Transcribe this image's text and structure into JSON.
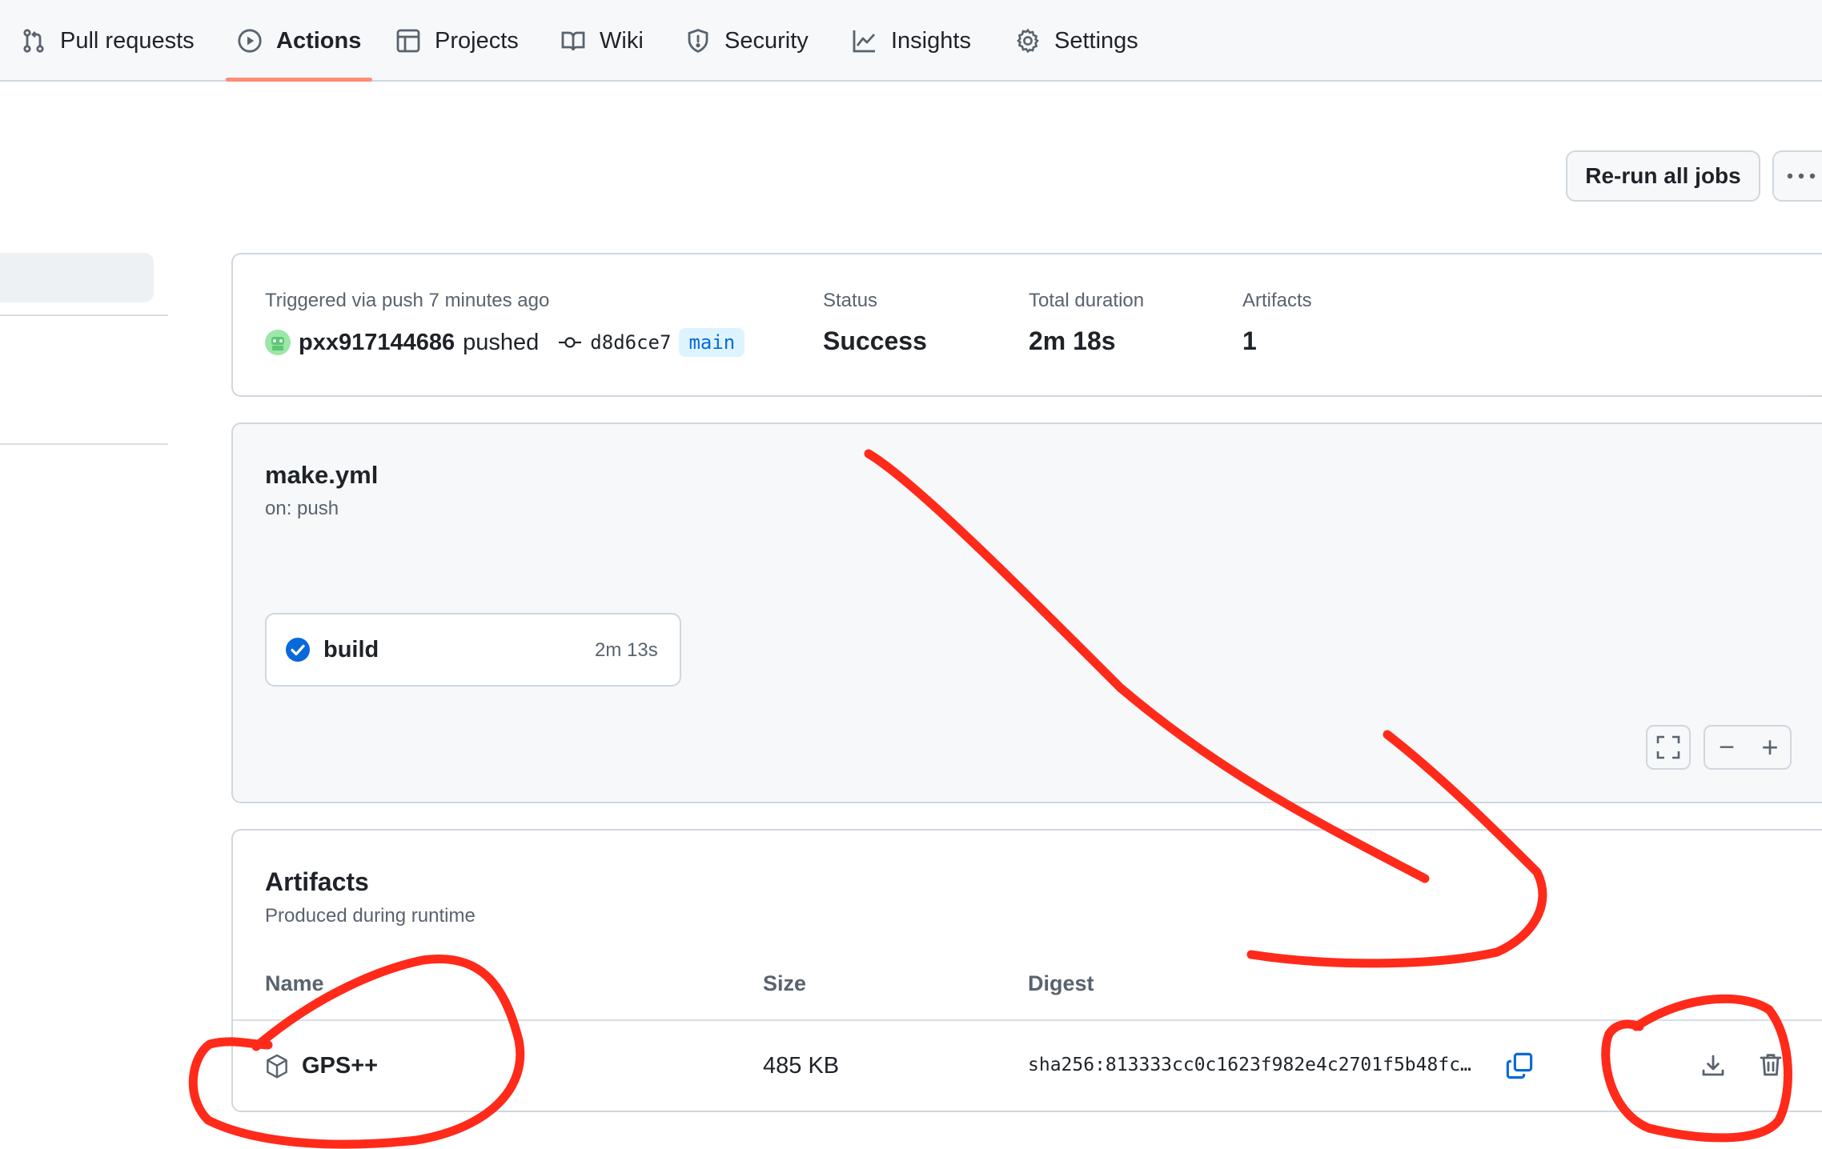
{
  "nav": {
    "tabs": [
      {
        "label": "Pull requests",
        "icon": "git-pull-request-icon"
      },
      {
        "label": "Actions",
        "icon": "play-icon",
        "active": true
      },
      {
        "label": "Projects",
        "icon": "table-icon"
      },
      {
        "label": "Wiki",
        "icon": "book-icon"
      },
      {
        "label": "Security",
        "icon": "shield-icon"
      },
      {
        "label": "Insights",
        "icon": "graph-icon"
      },
      {
        "label": "Settings",
        "icon": "gear-icon"
      }
    ]
  },
  "header": {
    "rerun_label": "Re-run all jobs",
    "more_label": "···"
  },
  "summary": {
    "trigger_text": "Triggered via push 7 minutes ago",
    "actor": "pxx917144686",
    "action": "pushed",
    "commit": "d8d6ce7",
    "branch": "main",
    "status_label": "Status",
    "status_value": "Success",
    "duration_label": "Total duration",
    "duration_value": "2m 18s",
    "artifacts_label": "Artifacts",
    "artifacts_value": "1"
  },
  "workflow": {
    "file": "make.yml",
    "trigger": "on: push",
    "job": {
      "name": "build",
      "duration": "2m 13s",
      "status": "success"
    },
    "zoom": {
      "fullscreen_icon": "fullscreen-icon",
      "minus": "−",
      "plus": "+"
    }
  },
  "artifacts": {
    "title": "Artifacts",
    "subtitle": "Produced during runtime",
    "columns": [
      "Name",
      "Size",
      "Digest"
    ],
    "rows": [
      {
        "name": "GPS++",
        "size": "485 KB",
        "digest": "sha256:813333cc0c1623f982e4c2701f5b48fc…"
      }
    ]
  },
  "colors": {
    "accent_underline": "#fd8c73",
    "success_blue": "#0969da",
    "annotation_red": "#ff2a1a"
  }
}
